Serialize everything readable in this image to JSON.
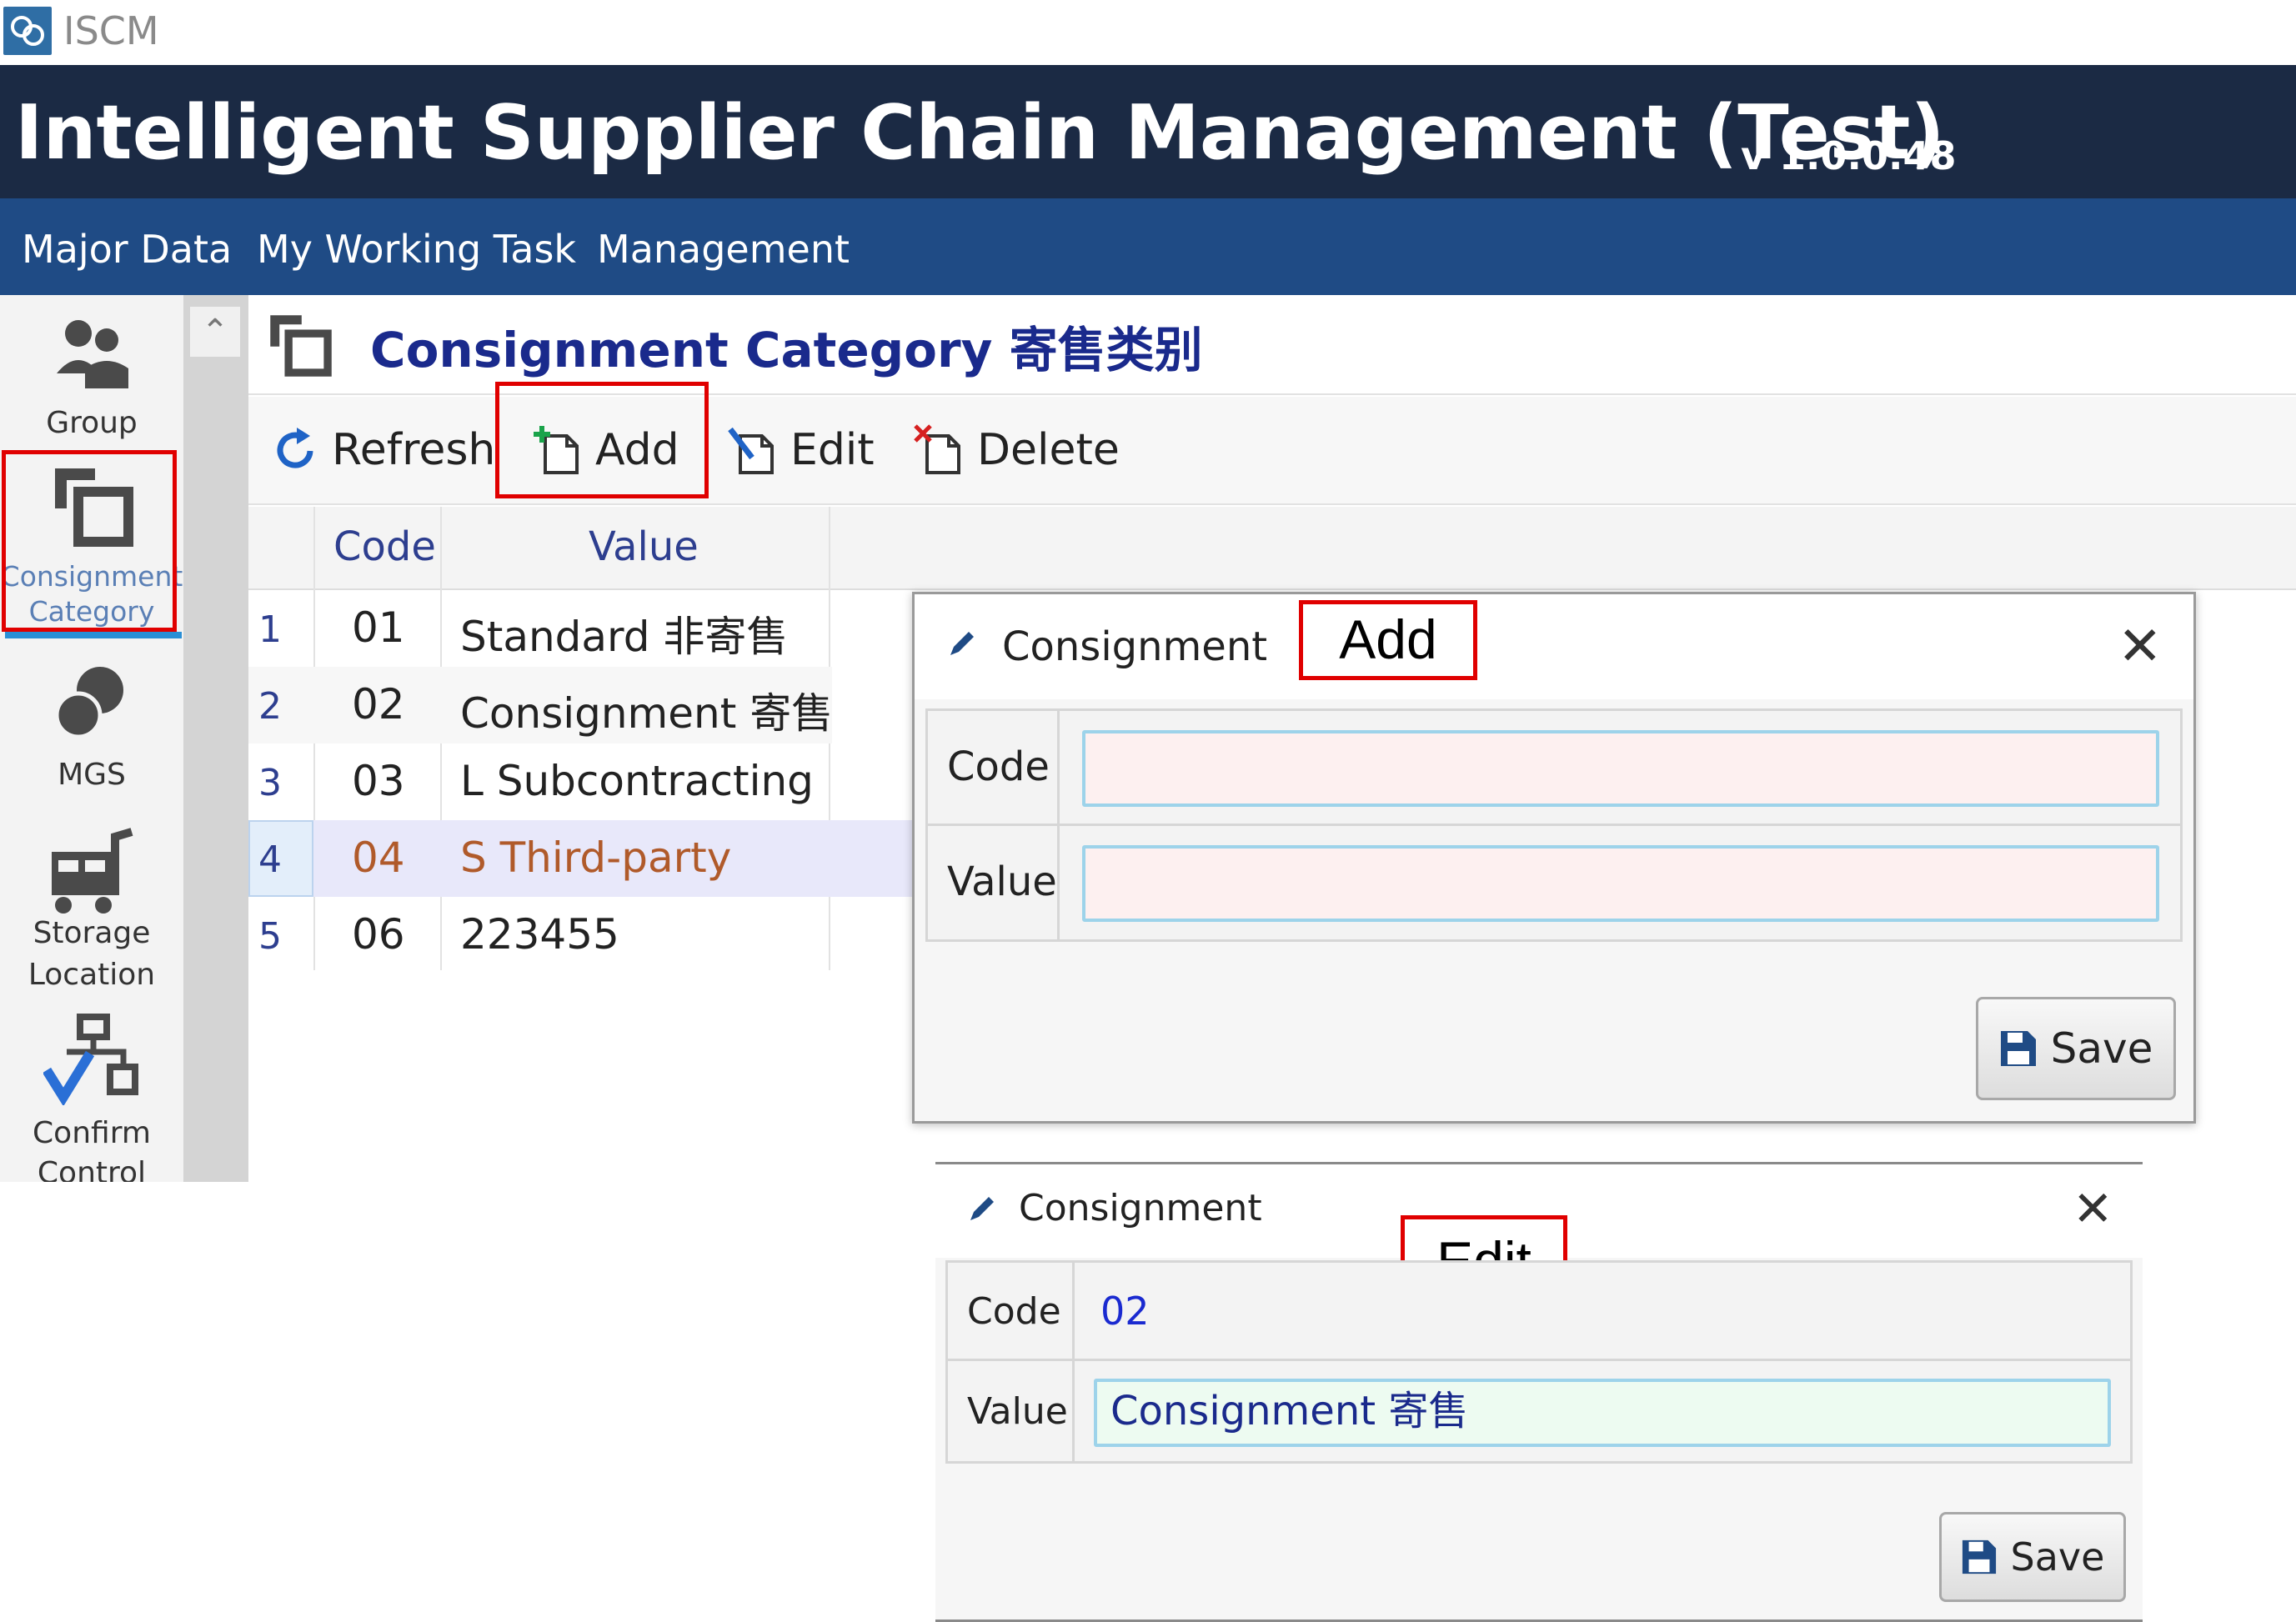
{
  "app": {
    "name": "ISCM",
    "title": "Intelligent Supplier Chain Management (Test)",
    "version": "v 1.0.0.48"
  },
  "menu": [
    "Major Data",
    "My Working Task",
    "Management"
  ],
  "sidebar": {
    "items": [
      {
        "label": "Group",
        "icon": "group-icon"
      },
      {
        "label": "Consignment Category",
        "label_line1": "Consignment",
        "label_line2": "Category",
        "icon": "consignment-category-icon",
        "active": true
      },
      {
        "label": "MGS",
        "icon": "mgs-icon"
      },
      {
        "label": "Storage Location",
        "label_line1": "Storage",
        "label_line2": "Location",
        "icon": "storage-location-icon"
      },
      {
        "label": "Confirm Control",
        "label_line1": "Confirm",
        "label_line2": "Control",
        "icon": "confirm-control-icon"
      }
    ]
  },
  "page": {
    "title": "Consignment Category 寄售类别"
  },
  "toolbar": {
    "refresh": "Refresh",
    "add": "Add",
    "edit": "Edit",
    "delete": "Delete"
  },
  "grid": {
    "columns": [
      "Code",
      "Value"
    ],
    "rows": [
      {
        "n": "1",
        "code": "01",
        "value": "Standard 非寄售"
      },
      {
        "n": "2",
        "code": "02",
        "value": "Consignment 寄售"
      },
      {
        "n": "3",
        "code": "03",
        "value": "L Subcontracting"
      },
      {
        "n": "4",
        "code": "04",
        "value": "S Third-party",
        "selected": true
      },
      {
        "n": "5",
        "code": "06",
        "value": "223455"
      }
    ]
  },
  "add_dialog": {
    "title": "Consignment",
    "tag": "Add",
    "code_label": "Code",
    "value_label": "Value",
    "code_value": "",
    "value_value": "",
    "save": "Save"
  },
  "edit_dialog": {
    "title": "Consignment",
    "tag": "Edit",
    "code_label": "Code",
    "value_label": "Value",
    "code_value": "02",
    "value_value": "Consignment 寄售",
    "save": "Save"
  },
  "colors": {
    "banner": "#1b2a44",
    "menubar": "#1f4b85",
    "accent": "#1a2a8c",
    "highlight": "#e00000",
    "selected_row": "#e8e8fa"
  }
}
